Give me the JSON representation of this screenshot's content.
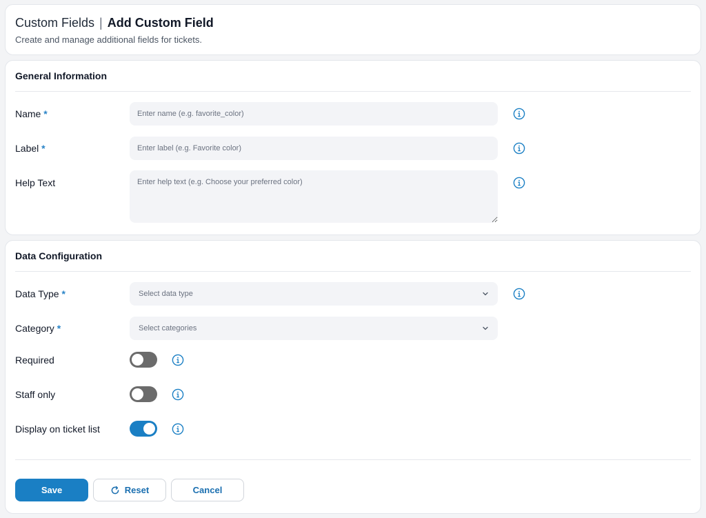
{
  "header": {
    "title": "Custom Fields",
    "separator": "|",
    "subtitle_title": "Add Custom Field",
    "description": "Create and manage additional fields for tickets."
  },
  "general": {
    "section_title": "General Information",
    "name": {
      "label": "Name",
      "required_marker": "*",
      "placeholder": "Enter name (e.g. favorite_color)",
      "value": ""
    },
    "label_field": {
      "label": "Label",
      "required_marker": "*",
      "placeholder": "Enter label (e.g. Favorite color)",
      "value": ""
    },
    "help_text": {
      "label": "Help Text",
      "placeholder": "Enter help text (e.g. Choose your preferred color)",
      "value": ""
    }
  },
  "data_config": {
    "section_title": "Data Configuration",
    "data_type": {
      "label": "Data Type",
      "required_marker": "*",
      "placeholder": "Select data type"
    },
    "category": {
      "label": "Category",
      "required_marker": "*",
      "placeholder": "Select categories"
    },
    "required_toggle": {
      "label": "Required",
      "enabled": false
    },
    "staff_only_toggle": {
      "label": "Staff only",
      "enabled": false
    },
    "display_on_list_toggle": {
      "label": "Display on ticket list",
      "enabled": true
    }
  },
  "actions": {
    "save_label": "Save",
    "reset_label": "Reset",
    "cancel_label": "Cancel"
  },
  "colors": {
    "primary": "#1a7fc4",
    "required_marker": "#2a84c7",
    "toggle_off": "#6b6b6b",
    "info_icon": "#1a7fc4"
  },
  "icons": {
    "info": "info-circle-icon",
    "chevron": "chevron-down-icon",
    "reset": "refresh-icon"
  }
}
